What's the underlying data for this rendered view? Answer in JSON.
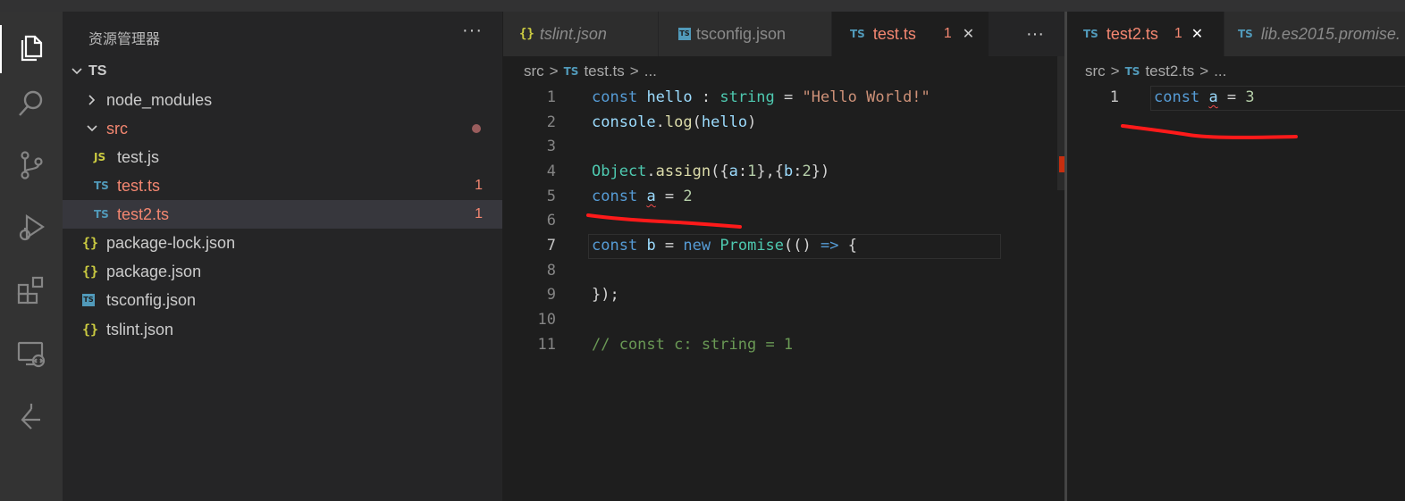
{
  "explorer": {
    "title": "资源管理器",
    "more": "···",
    "root": "TS",
    "items": [
      {
        "label": "node_modules",
        "icon": "chevron-right-icon",
        "count": ""
      },
      {
        "label": "src",
        "icon": "chevron-down-icon",
        "count": ""
      },
      {
        "label": "test.js",
        "icon": "JS",
        "count": ""
      },
      {
        "label": "test.ts",
        "icon": "TS",
        "count": "1"
      },
      {
        "label": "test2.ts",
        "icon": "TS",
        "count": "1"
      },
      {
        "label": "package-lock.json",
        "icon": "{}",
        "count": ""
      },
      {
        "label": "package.json",
        "icon": "{}",
        "count": ""
      },
      {
        "label": "tsconfig.json",
        "icon": "TS",
        "count": ""
      },
      {
        "label": "tslint.json",
        "icon": "{}",
        "count": ""
      }
    ]
  },
  "editor1": {
    "tabs": [
      {
        "label": "tslint.json",
        "icon": "{}",
        "badge": ""
      },
      {
        "label": "tsconfig.json",
        "icon": "TS",
        "badge": ""
      },
      {
        "label": "test.ts",
        "icon": "TS",
        "badge": "1",
        "close": "✕"
      }
    ],
    "more": "···",
    "breadcrumb": [
      "src",
      ">",
      "TS",
      "test.ts",
      ">",
      "..."
    ],
    "line_numbers": [
      "1",
      "2",
      "3",
      "4",
      "5",
      "6",
      "7",
      "8",
      "9",
      "10",
      "11"
    ],
    "lines": {
      "l1": {
        "kw": "const",
        "sp1": " ",
        "id": "hello",
        "op1": " : ",
        "type": "string",
        "op2": " = ",
        "str": "\"Hello World!\""
      },
      "l2": {
        "obj": "console",
        "dot": ".",
        "fn": "log",
        "p1": "(",
        "arg": "hello",
        "p2": ")"
      },
      "l4": {
        "cls": "Object",
        "dot": ".",
        "fn": "assign",
        "rest1": "({",
        "k1": "a",
        "c1": ":",
        "n1": "1",
        "mid": "},{",
        "k2": "b",
        "c2": ":",
        "n2": "2",
        "end": "})"
      },
      "l5": {
        "kw": "const",
        "sp": " ",
        "id": "a",
        "op": " = ",
        "num": "2"
      },
      "l7": {
        "kw": "const",
        "sp": " ",
        "id": "b",
        "op": " = ",
        "kw2": "new",
        "sp2": " ",
        "cls": "Promise",
        "p": "(() ",
        "arrow": "=>",
        "br": " {"
      },
      "l9": "});",
      "l11": "// const c: string = 1"
    }
  },
  "editor2": {
    "tabs": [
      {
        "label": "test2.ts",
        "icon": "TS",
        "badge": "1",
        "close": "✕"
      },
      {
        "label": "lib.es2015.promise.",
        "icon": "TS"
      }
    ],
    "breadcrumb": [
      "src",
      ">",
      "TS",
      "test2.ts",
      ">",
      "..."
    ],
    "line_numbers": [
      "1"
    ],
    "line1": {
      "kw": "const",
      "sp": " ",
      "id": "a",
      "op": " = ",
      "num": "3"
    }
  },
  "colors": {
    "accent": "#519aba",
    "error": "#f48771",
    "annotation": "#ff0000"
  }
}
